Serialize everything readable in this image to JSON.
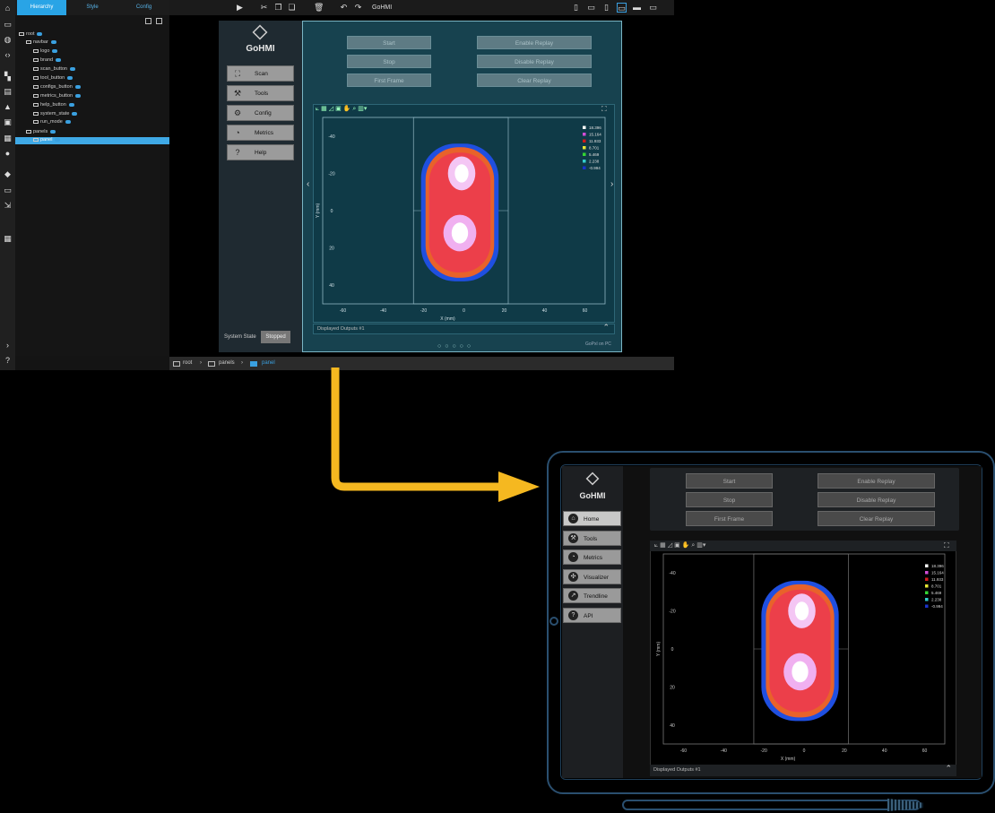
{
  "editor": {
    "tabs": [
      "Hierarchy",
      "Style",
      "Config"
    ],
    "app_title": "GoHMI",
    "tree": [
      {
        "label": "root",
        "indent": 0
      },
      {
        "label": "navbar",
        "indent": 1
      },
      {
        "label": "logo",
        "indent": 2
      },
      {
        "label": "brand",
        "indent": 2
      },
      {
        "label": "scan_button",
        "indent": 2
      },
      {
        "label": "tool_button",
        "indent": 2
      },
      {
        "label": "configs_button",
        "indent": 2
      },
      {
        "label": "metrics_button",
        "indent": 2
      },
      {
        "label": "help_button",
        "indent": 2
      },
      {
        "label": "system_state",
        "indent": 2
      },
      {
        "label": "run_mode",
        "indent": 2
      },
      {
        "label": "panels",
        "indent": 1
      },
      {
        "label": "panel",
        "indent": 2
      }
    ],
    "breadcrumb": [
      "root",
      "panels",
      "panel"
    ],
    "nav": {
      "brand": "GoHMI",
      "items": [
        {
          "label": "Scan",
          "icon": "scan-icon",
          "glyph": "⛶"
        },
        {
          "label": "Tools",
          "icon": "tools-icon",
          "glyph": "⚒"
        },
        {
          "label": "Config",
          "icon": "config-icon",
          "glyph": "⚙"
        },
        {
          "label": "Metrics",
          "icon": "gauge-icon",
          "glyph": "◔"
        },
        {
          "label": "Help",
          "icon": "help-icon",
          "glyph": "?"
        }
      ],
      "system_state_label": "System State",
      "system_state_value": "Stopped"
    },
    "buttons": {
      "start": "Start",
      "stop": "Stop",
      "first_frame": "First Frame",
      "enable_replay": "Enable Replay",
      "disable_replay": "Disable  Replay",
      "clear_replay": "Clear Replay"
    },
    "footer_label": "Displayed Outputs #1",
    "corner_label": "GoPxl on PC"
  },
  "device": {
    "nav": {
      "brand": "GoHMI",
      "items": [
        {
          "label": "Home",
          "icon": "home-icon",
          "glyph": "⌂"
        },
        {
          "label": "Tools",
          "icon": "tools-icon",
          "glyph": "⚒"
        },
        {
          "label": "Metrics",
          "icon": "gauge-icon",
          "glyph": "◔"
        },
        {
          "label": "Visualizer",
          "icon": "visualizer-icon",
          "glyph": "✣"
        },
        {
          "label": "Trendline",
          "icon": "trendline-icon",
          "glyph": "↗"
        },
        {
          "label": "API",
          "icon": "help-icon",
          "glyph": "?"
        }
      ]
    },
    "buttons": {
      "start": "Start",
      "stop": "Stop",
      "first_frame": "First Frame",
      "enable_replay": "Enable Replay",
      "disable_replay": "Disable  Replay",
      "clear_replay": "Clear Replay"
    },
    "footer_label": "Displayed Outputs #1"
  },
  "chart_data": {
    "type": "heatmap",
    "xlabel": "X (mm)",
    "ylabel": "Y (mm)",
    "x_ticks": [
      -60,
      -40,
      -20,
      0,
      20,
      40,
      60
    ],
    "y_ticks": [
      -40,
      -20,
      0,
      20,
      40
    ],
    "legend": [
      {
        "label": "18.396",
        "color": "#ffffff"
      },
      {
        "label": "15.164",
        "color": "#d24dd6"
      },
      {
        "label": "11.933",
        "color": "#d01a1a"
      },
      {
        "label": "8.701",
        "color": "#e6e633"
      },
      {
        "label": "5.469",
        "color": "#33d633"
      },
      {
        "label": "2.238",
        "color": "#33cccc"
      },
      {
        "label": "-0.994",
        "color": "#1a33cc"
      }
    ]
  },
  "colors": {
    "accent": "#29a4e6",
    "arrow": "#f5b820",
    "panel_bg": "#17424f"
  }
}
